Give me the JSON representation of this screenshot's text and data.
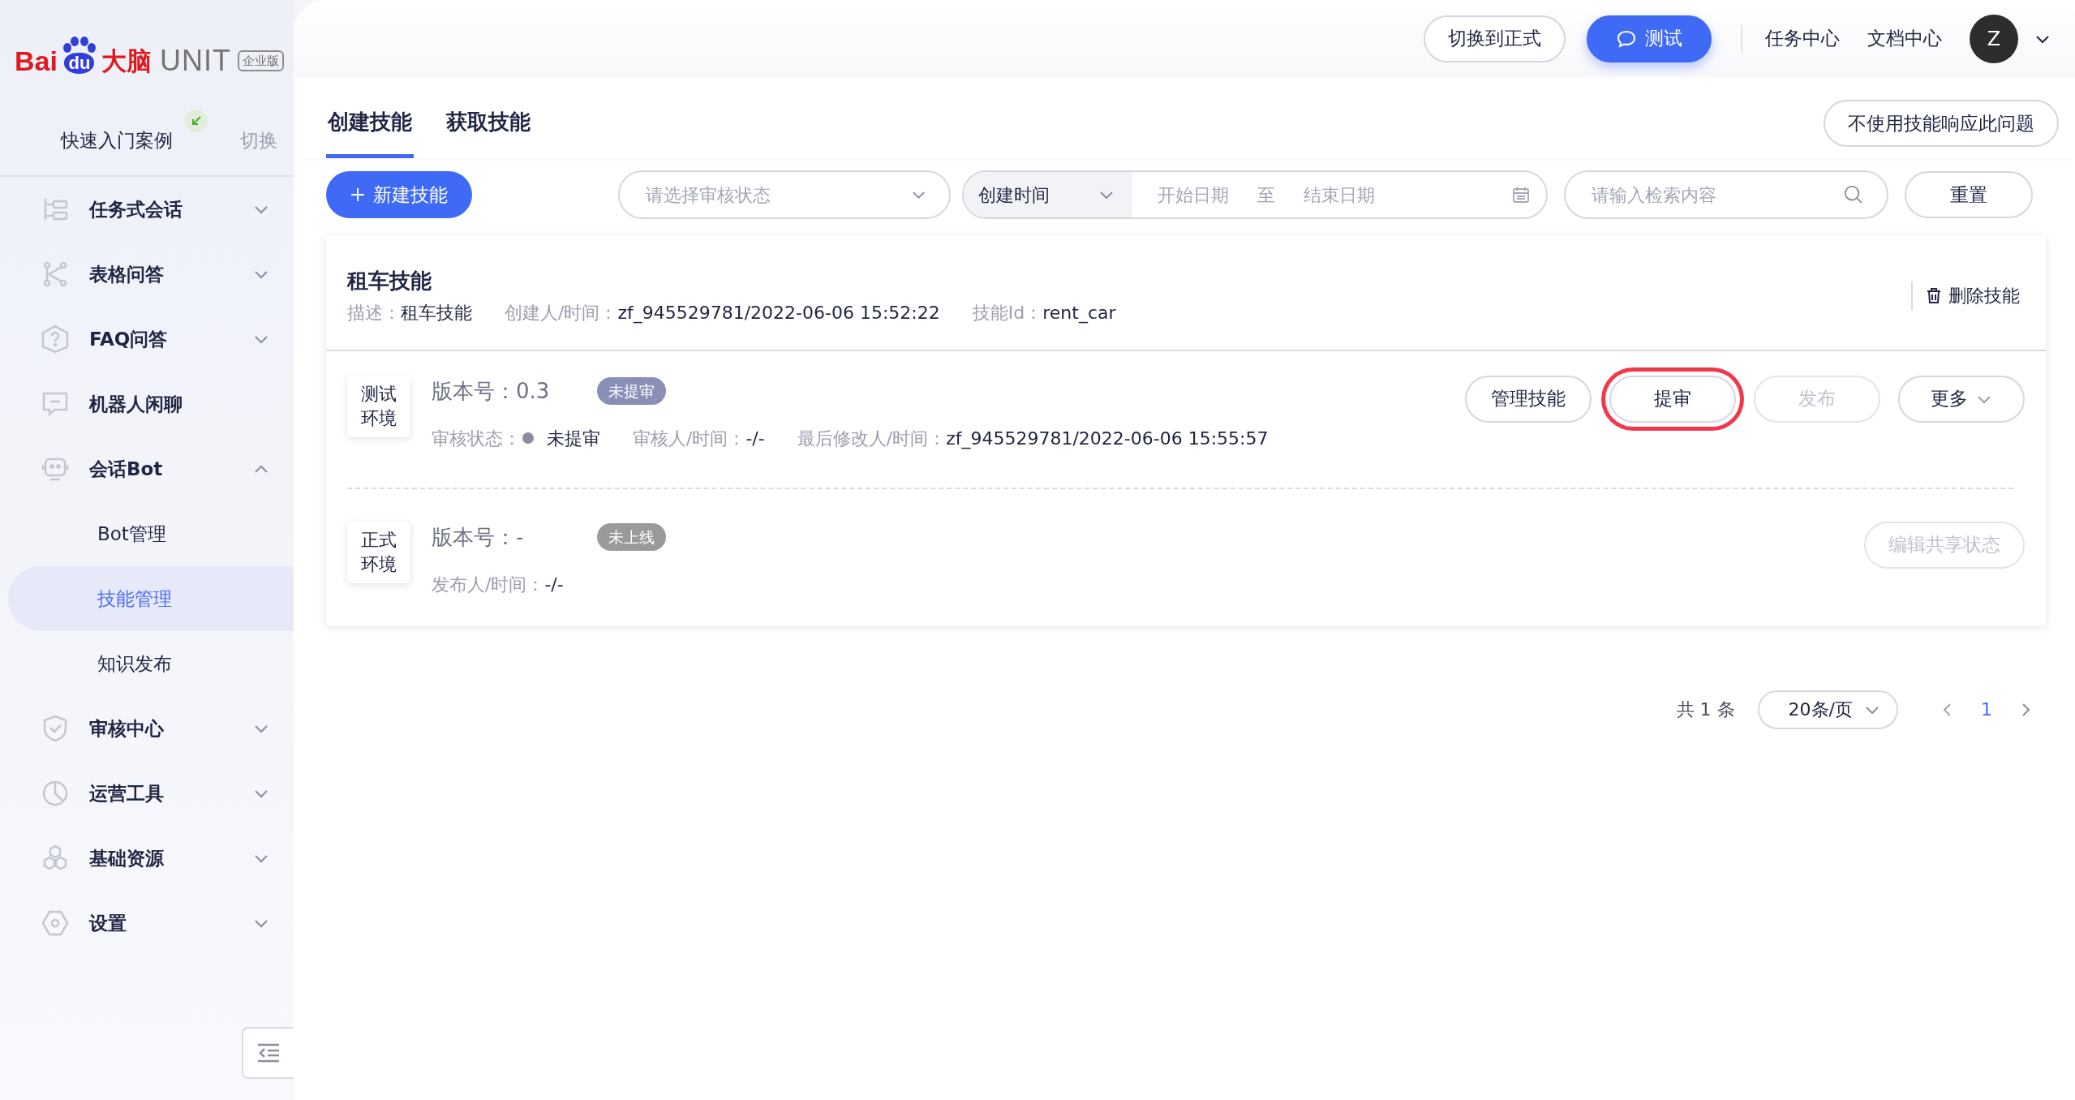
{
  "logo": {
    "brand_left": "Bai",
    "brand_mid": "du",
    "brand_cn": "大脑",
    "product": "UNIT",
    "edition": "企业版"
  },
  "quick_start": {
    "label": "快速入门案例",
    "switch": "切换"
  },
  "sidebar": {
    "items": [
      {
        "label": "任务式会话",
        "kind": "group",
        "expanded": false
      },
      {
        "label": "表格问答",
        "kind": "group",
        "expanded": false
      },
      {
        "label": "FAQ问答",
        "kind": "group",
        "expanded": false
      },
      {
        "label": "机器人闲聊",
        "kind": "item"
      },
      {
        "label": "会话Bot",
        "kind": "group",
        "expanded": true,
        "children": [
          {
            "label": "Bot管理",
            "selected": false
          },
          {
            "label": "技能管理",
            "selected": true
          },
          {
            "label": "知识发布",
            "selected": false
          }
        ]
      },
      {
        "label": "审核中心",
        "kind": "group",
        "expanded": false
      },
      {
        "label": "运营工具",
        "kind": "group",
        "expanded": false
      },
      {
        "label": "基础资源",
        "kind": "group",
        "expanded": false
      },
      {
        "label": "设置",
        "kind": "group",
        "expanded": false
      }
    ]
  },
  "header": {
    "switch_button": "切换到正式",
    "test_button": "测试",
    "links": [
      "任务中心",
      "文档中心"
    ],
    "avatar": "Z"
  },
  "tabs": [
    {
      "label": "创建技能",
      "selected": true
    },
    {
      "label": "获取技能",
      "selected": false
    }
  ],
  "no_skill_button": "不使用技能响应此问题",
  "filters": {
    "new_button": "新建技能",
    "status_select": {
      "placeholder": "请选择审核状态"
    },
    "date_type": "创建时间",
    "start_date": {
      "placeholder": "开始日期"
    },
    "range_separator": "至",
    "end_date": {
      "placeholder": "结束日期"
    },
    "search": {
      "placeholder": "请输入检索内容"
    },
    "reset_button": "重置"
  },
  "skill": {
    "title": "租车技能",
    "delete_button": "删除技能",
    "meta": [
      {
        "label": "描述：",
        "value": "租车技能"
      },
      {
        "label": "创建人/时间：",
        "value": "zf_945529781/2022-06-06 15:52:22"
      },
      {
        "label": "技能Id：",
        "value": "rent_car"
      }
    ],
    "environments": [
      {
        "name": "测试环境",
        "version_label": "版本号：",
        "version": "0.3",
        "status": {
          "text": "未提审",
          "color": "#8a8fb6"
        },
        "fields": [
          {
            "label": "审核状态：",
            "value": "未提审",
            "kind": "dot"
          },
          {
            "label": "审核人/时间：",
            "value": "-/-",
            "kind": "plain"
          },
          {
            "label": "最后修改人/时间：",
            "value": "zf_945529781/2022-06-06 15:55:57",
            "kind": "plain"
          }
        ],
        "actions": [
          {
            "label": "管理技能",
            "disabled": false,
            "highlighted": false,
            "kind": "button"
          },
          {
            "label": "提审",
            "disabled": false,
            "highlighted": true,
            "kind": "button"
          },
          {
            "label": "发布",
            "disabled": true,
            "highlighted": false,
            "kind": "button"
          },
          {
            "label": "更多",
            "disabled": false,
            "highlighted": false,
            "kind": "dropdown"
          }
        ]
      },
      {
        "name": "正式环境",
        "version_label": "版本号：",
        "version": "-",
        "status": {
          "text": "未上线",
          "color": "#9a9a9a"
        },
        "fields": [
          {
            "label": "发布人/时间：",
            "value": "-/-",
            "kind": "plain"
          }
        ],
        "actions": [
          {
            "label": "编辑共享状态",
            "disabled": true,
            "highlighted": false,
            "kind": "button"
          }
        ]
      }
    ]
  },
  "pagination": {
    "total": "共 1 条",
    "page_size": "20条/页",
    "pages": [
      {
        "label": "1",
        "selected": true
      }
    ]
  }
}
